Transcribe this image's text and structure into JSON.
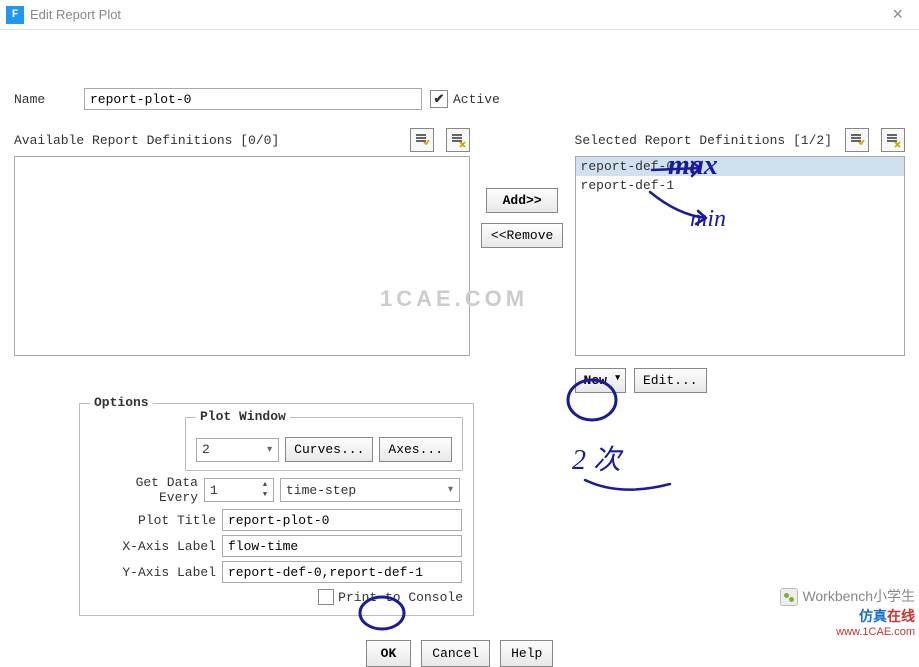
{
  "window": {
    "title": "Edit Report Plot"
  },
  "name": {
    "label": "Name",
    "value": "report-plot-0"
  },
  "active": {
    "label": "Active",
    "checked": "✔"
  },
  "available": {
    "label": "Available Report Definitions [0/0]"
  },
  "selected": {
    "label": "Selected Report Definitions [1/2]",
    "items": [
      "report-def-0",
      "report-def-1"
    ]
  },
  "transfer": {
    "add": "Add>>",
    "remove": "<<Remove"
  },
  "newedit": {
    "new": "New",
    "edit": "Edit..."
  },
  "options": {
    "legend": "Options",
    "plotwindow": {
      "legend": "Plot Window",
      "value": "2",
      "curves": "Curves...",
      "axes": "Axes..."
    },
    "getdata": {
      "label": "Get Data Every",
      "value": "1",
      "unit": "time-step"
    },
    "plottitle": {
      "label": "Plot Title",
      "value": "report-plot-0"
    },
    "xaxis": {
      "label": "X-Axis Label",
      "value": "flow-time"
    },
    "yaxis": {
      "label": "Y-Axis Label",
      "value": "report-def-0,report-def-1"
    },
    "print": "Print to Console"
  },
  "buttons": {
    "ok": "OK",
    "cancel": "Cancel",
    "help": "Help"
  },
  "watermarks": {
    "center": "1CAE.COM",
    "footer1": "Workbench小学生",
    "footer2a": "仿真",
    "footer2b": "在线",
    "footer3": "www.1CAE.com"
  },
  "handwriting": {
    "max": "max",
    "min": "min",
    "twice": "2 次"
  }
}
